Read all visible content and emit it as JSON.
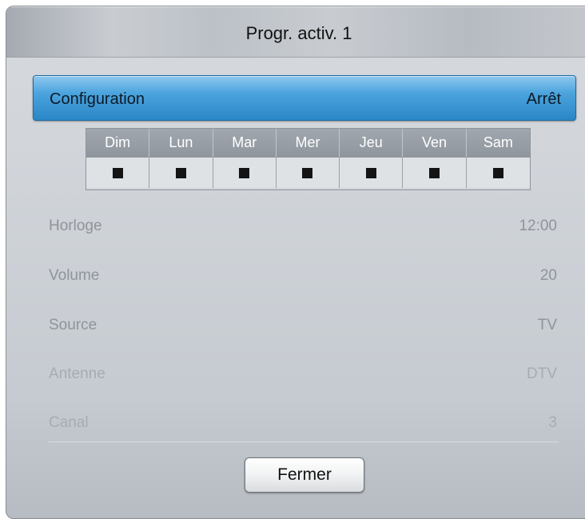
{
  "dialog": {
    "title": "Progr. activ. 1"
  },
  "configuration": {
    "label": "Configuration",
    "value": "Arrêt",
    "accent_color": "#3a97d6"
  },
  "days": {
    "labels": [
      "Dim",
      "Lun",
      "Mar",
      "Mer",
      "Jeu",
      "Ven",
      "Sam"
    ],
    "checked": [
      true,
      true,
      true,
      true,
      true,
      true,
      true
    ]
  },
  "settings": [
    {
      "label": "Horloge",
      "value": "12:00"
    },
    {
      "label": "Volume",
      "value": "20"
    },
    {
      "label": "Source",
      "value": "TV"
    },
    {
      "label": "Antenne",
      "value": "DTV"
    },
    {
      "label": "Canal",
      "value": "3"
    }
  ],
  "footer": {
    "close_label": "Fermer"
  }
}
